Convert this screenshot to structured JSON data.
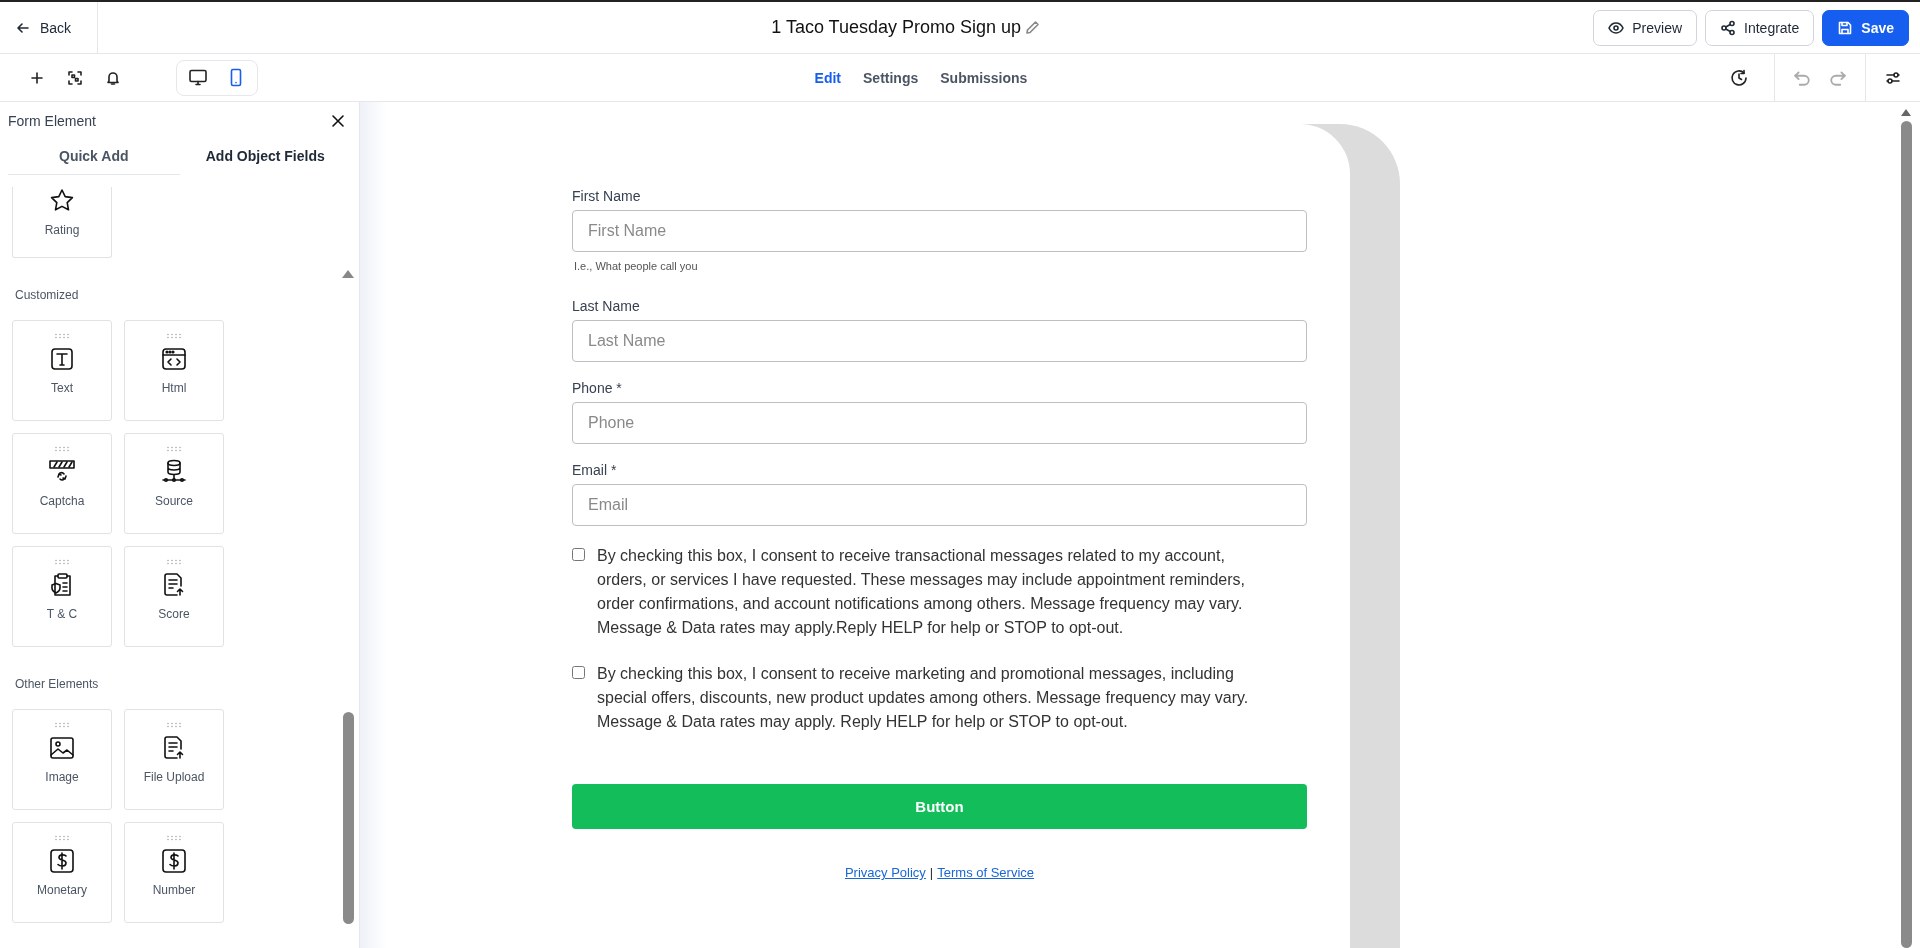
{
  "header": {
    "back": "Back",
    "title": "1 Taco Tuesday Promo Sign up",
    "buttons": [
      {
        "label": "Preview",
        "kind": "preview"
      },
      {
        "label": "Integrate",
        "kind": "integrate"
      },
      {
        "label": "Save",
        "kind": "save"
      }
    ]
  },
  "toolbar": {
    "devices": [
      {
        "kind": "desktop",
        "selected": false
      },
      {
        "kind": "mobile",
        "selected": true
      }
    ],
    "tabs": [
      {
        "label": "Edit",
        "selected": true
      },
      {
        "label": "Settings",
        "selected": false
      },
      {
        "label": "Submissions",
        "selected": false
      }
    ],
    "undo": {
      "disabled": true
    },
    "redo": {
      "disabled": true
    }
  },
  "panel": {
    "title": "Form Element",
    "tabs": [
      {
        "label": "Quick Add",
        "selected": false
      },
      {
        "label": "Add Object Fields",
        "selected": true
      }
    ],
    "sections": [
      {
        "items": [
          {
            "label": "Rating",
            "kind": "rating"
          }
        ]
      },
      {
        "title": "Customized",
        "items": [
          {
            "label": "Text",
            "kind": "text"
          },
          {
            "label": "Html",
            "kind": "html"
          },
          {
            "label": "Captcha",
            "kind": "captcha"
          },
          {
            "label": "Source",
            "kind": "source"
          },
          {
            "label": "T & C",
            "kind": "terms"
          },
          {
            "label": "Score",
            "kind": "score"
          }
        ]
      },
      {
        "title": "Other Elements",
        "items": [
          {
            "label": "Image",
            "kind": "image"
          },
          {
            "label": "File Upload",
            "kind": "upload"
          },
          {
            "label": "Monetary",
            "kind": "monetary"
          },
          {
            "label": "Number",
            "kind": "number"
          }
        ]
      }
    ]
  },
  "form": {
    "fields": [
      {
        "label": "First Name",
        "placeholder": "First Name",
        "hint": "I.e., What people call you"
      },
      {
        "label": "Last Name",
        "placeholder": "Last Name"
      },
      {
        "label": "Phone *",
        "placeholder": "Phone"
      },
      {
        "label": "Email *",
        "placeholder": "Email"
      }
    ],
    "consents": [
      {
        "text": "By checking this box, I consent to receive transactional messages related to my account, orders, or services I have requested. These messages may include appointment reminders, order confirmations, and account notifications among others. Message frequency may vary. Message & Data rates may apply.Reply HELP for help or STOP to opt-out.",
        "checked": false
      },
      {
        "text": "By checking this box, I consent to receive marketing and promotional messages, including special offers, discounts, new product updates among others. Message frequency may vary. Message & Data rates may apply. Reply HELP for help or STOP to opt-out.",
        "checked": false
      }
    ],
    "submit": "Button",
    "links": [
      "Privacy Policy",
      "Terms of Service"
    ],
    "separator": "|"
  }
}
